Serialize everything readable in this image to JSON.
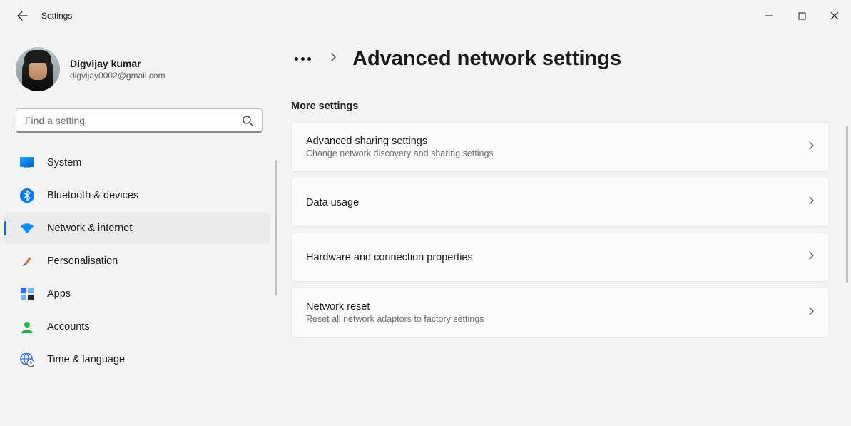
{
  "app": {
    "title": "Settings"
  },
  "user": {
    "name": "Digvijay kumar",
    "email": "digvijay0002@gmail.com"
  },
  "search": {
    "placeholder": "Find a setting"
  },
  "sidebar": {
    "items": [
      {
        "label": "System"
      },
      {
        "label": "Bluetooth & devices"
      },
      {
        "label": "Network & internet"
      },
      {
        "label": "Personalisation"
      },
      {
        "label": "Apps"
      },
      {
        "label": "Accounts"
      },
      {
        "label": "Time & language"
      }
    ],
    "selected_index": 2
  },
  "breadcrumb": {
    "title": "Advanced network settings"
  },
  "section": {
    "heading": "More settings"
  },
  "cards": [
    {
      "title": "Advanced sharing settings",
      "sub": "Change network discovery and sharing settings"
    },
    {
      "title": "Data usage",
      "sub": ""
    },
    {
      "title": "Hardware and connection properties",
      "sub": ""
    },
    {
      "title": "Network reset",
      "sub": "Reset all network adaptors to factory settings"
    }
  ]
}
